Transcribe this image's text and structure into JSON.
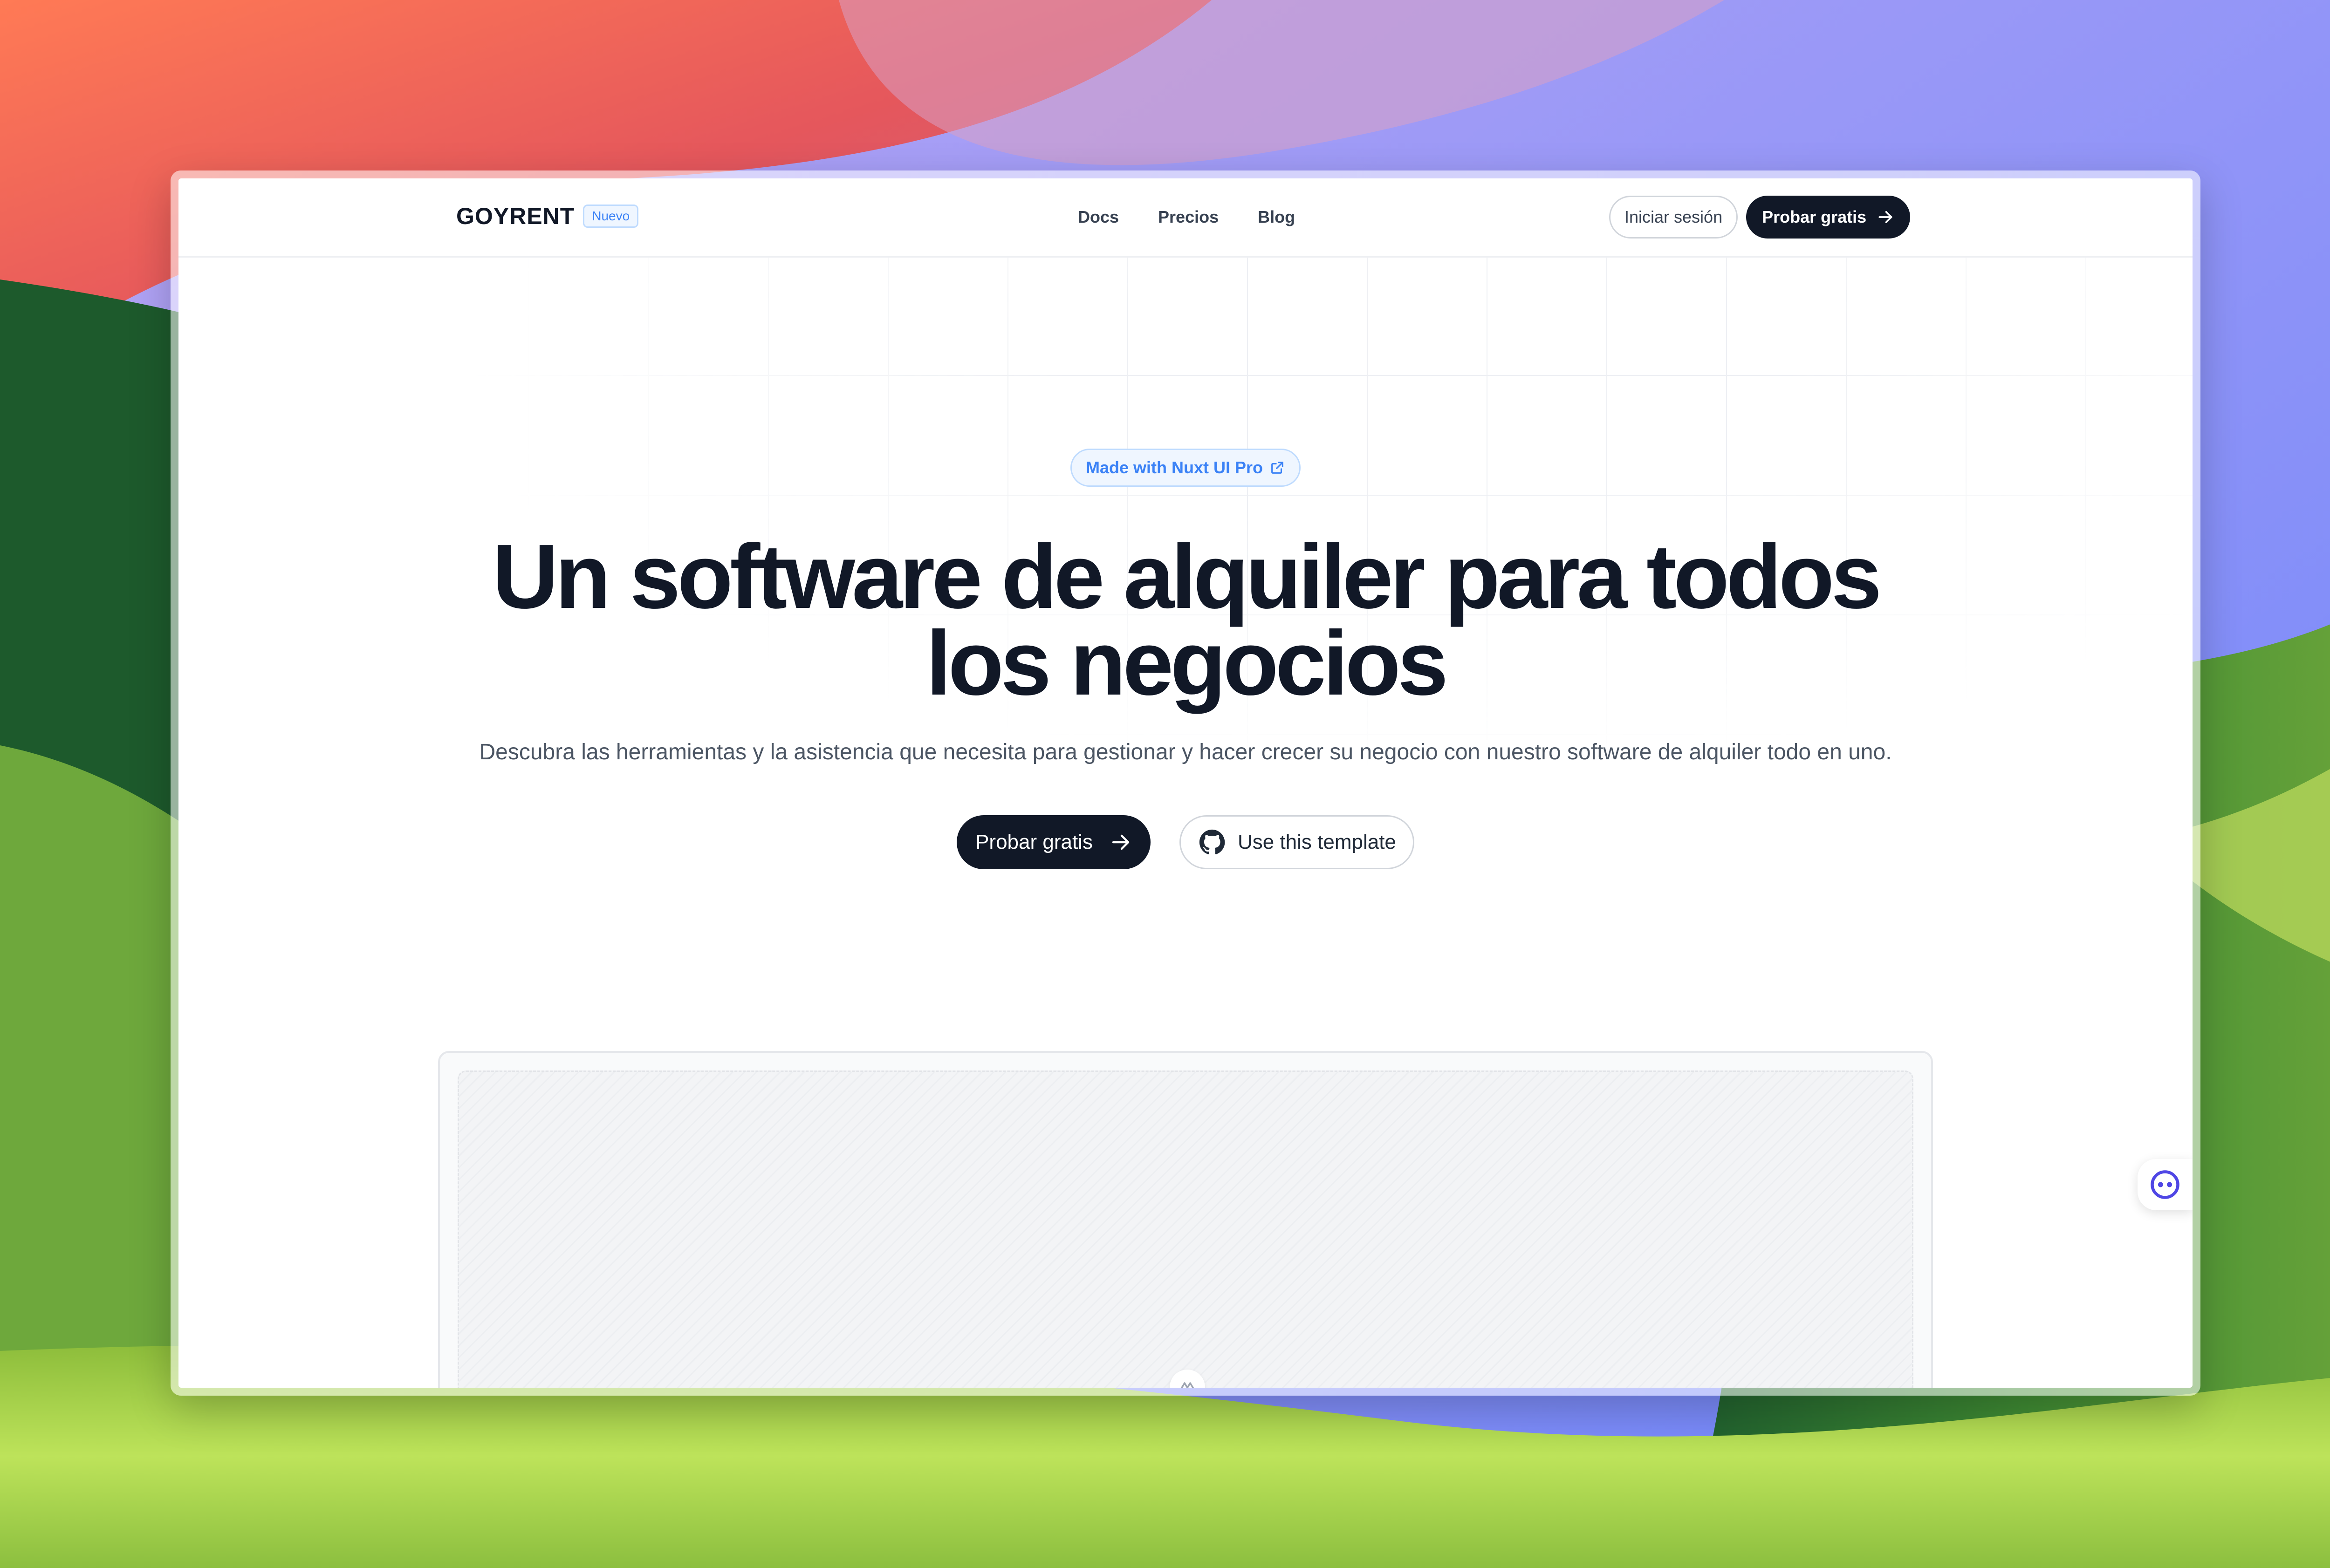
{
  "header": {
    "logo": "GOYRENT",
    "badge": "Nuevo",
    "nav": [
      "Docs",
      "Precios",
      "Blog"
    ],
    "login_label": "Iniciar sesión",
    "cta_label": "Probar gratis"
  },
  "hero": {
    "chip_label": "Made with Nuxt UI Pro",
    "title": "Un software de alquiler para todos los negocios",
    "subtitle": "Descubra las herramientas y la asistencia que necesita para gestionar y hacer crecer su negocio con nuestro software de alquiler todo en uno.",
    "primary_label": "Probar gratis",
    "secondary_label": "Use this template"
  },
  "icons": {
    "chip": "external-link-icon",
    "primary": "arrow-right-icon",
    "secondary": "github-icon",
    "preview": "nuxt-logo-icon",
    "widget": "chat-bot-icon"
  },
  "colors": {
    "primary_dark": "#111827",
    "accent_blue": "#3b82f6",
    "text_muted": "#4b5563"
  }
}
